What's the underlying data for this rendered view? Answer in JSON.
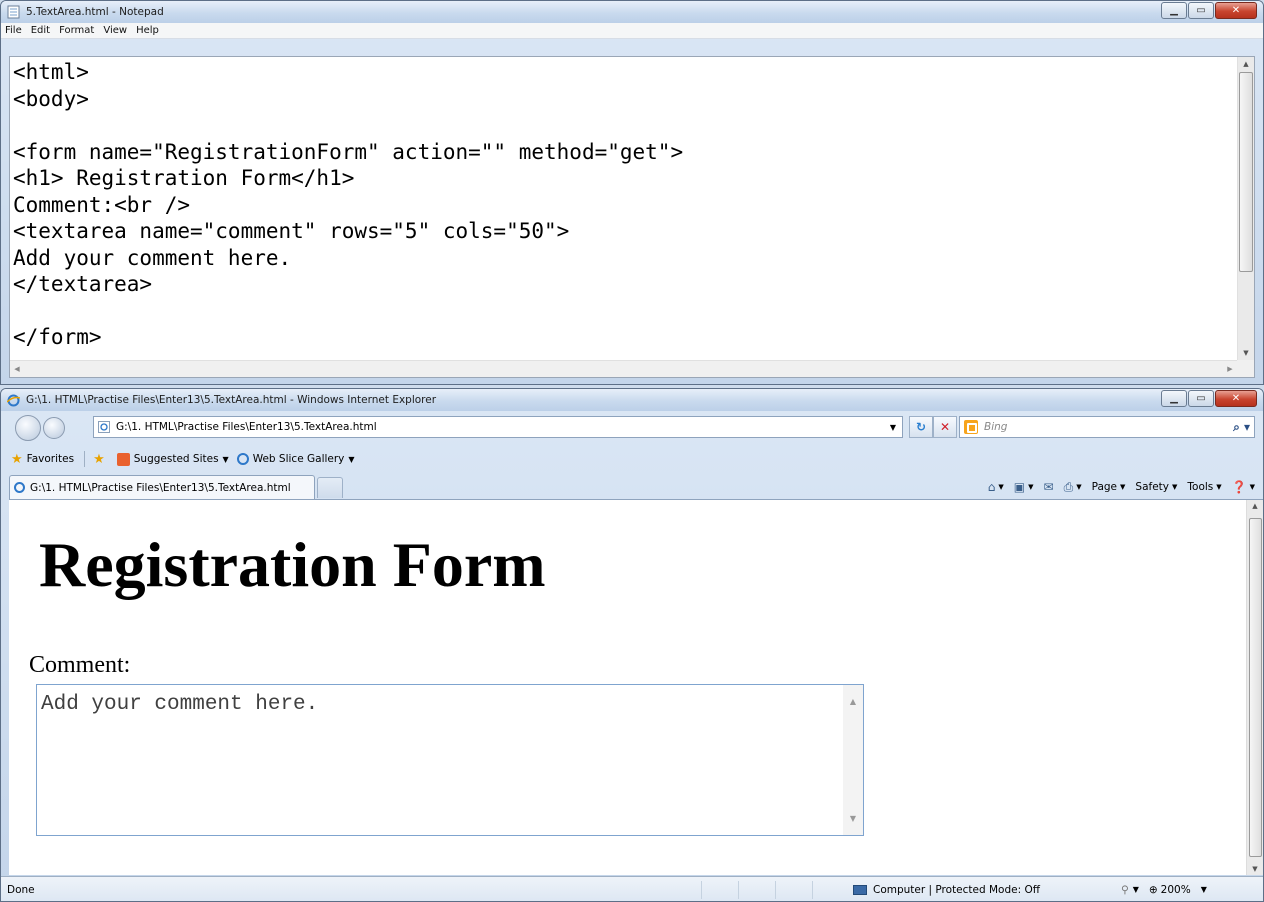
{
  "notepad": {
    "title": "5.TextArea.html - Notepad",
    "menu": [
      "File",
      "Edit",
      "Format",
      "View",
      "Help"
    ],
    "content": "<html>\n<body>\n\n<form name=\"RegistrationForm\" action=\"\" method=\"get\">\n<h1> Registration Form</h1>\nComment:<br />\n<textarea name=\"comment\" rows=\"5\" cols=\"50\">\nAdd your comment here.\n</textarea>\n\n</form>"
  },
  "ie": {
    "title": "G:\\1. HTML\\Practise Files\\Enter13\\5.TextArea.html - Windows Internet Explorer",
    "address": "G:\\1. HTML\\Practise Files\\Enter13\\5.TextArea.html",
    "search_placeholder": "Bing",
    "favorites_label": "Favorites",
    "suggested_sites": "Suggested Sites",
    "web_slice_gallery": "Web Slice Gallery",
    "tab_title": "G:\\1. HTML\\Practise Files\\Enter13\\5.TextArea.html",
    "commands": {
      "page": "Page",
      "safety": "Safety",
      "tools": "Tools"
    },
    "page": {
      "heading": "Registration Form",
      "label": "Comment:",
      "textarea_value": "Add your comment here."
    },
    "status": {
      "text": "Done",
      "zone": "Computer | Protected Mode: Off",
      "zoom": "200%"
    }
  },
  "colors": {
    "titlebar": "#c9daee",
    "close_button": "#c8442f",
    "link_blue": "#2e78c9"
  }
}
